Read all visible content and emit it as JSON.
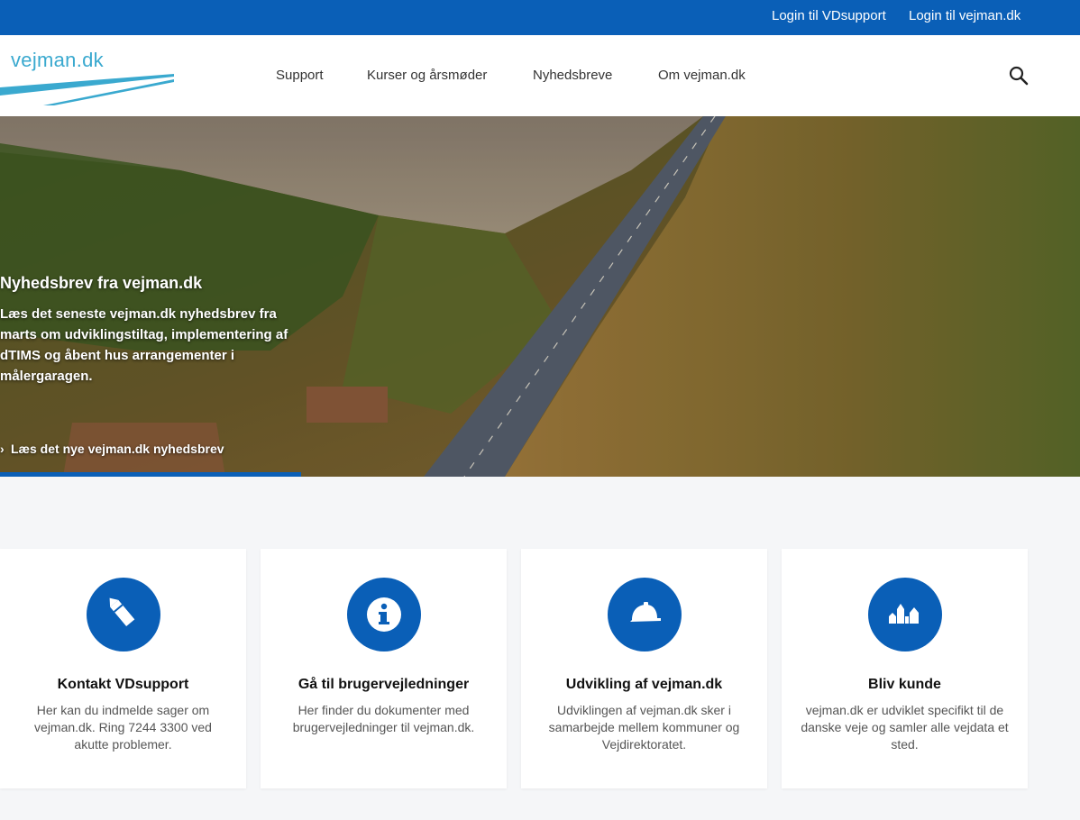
{
  "topbar": {
    "login_vdsupport": "Login til VDsupport",
    "login_vejman": "Login til vejman.dk"
  },
  "header": {
    "logo_text": "vejman.dk",
    "nav": [
      "Support",
      "Kurser og årsmøder",
      "Nyhedsbreve",
      "Om vejman.dk"
    ],
    "search_icon": "search-icon"
  },
  "hero": {
    "title": "Nyhedsbrev fra vejman.dk",
    "text": "Læs det seneste vejman.dk nyhedsbrev fra marts om udviklingstiltag, implementering af dTIMS og åbent hus arrangementer i målergaragen.",
    "link": "Læs det nye vejman.dk nyhedsbrev"
  },
  "cards": [
    {
      "icon": "pencil-icon",
      "title": "Kontakt VDsupport",
      "text": "Her kan du indmelde sager om vejman.dk. Ring 7244 3300 ved akutte problemer."
    },
    {
      "icon": "info-icon",
      "title": "Gå til brugervejledninger",
      "text": "Her finder du dokumenter med brugervejledninger til vejman.dk."
    },
    {
      "icon": "hard-hat-icon",
      "title": "Udvikling af vejman.dk",
      "text": "Udviklingen af vejman.dk sker i samarbejde mellem kommuner og Vejdirektoratet."
    },
    {
      "icon": "town-icon",
      "title": "Bliv kunde",
      "text": "vejman.dk er udviklet specifikt til de danske veje og samler alle vejdata et sted."
    }
  ],
  "colors": {
    "brand_blue": "#0a5fb7",
    "logo_teal": "#3aa9cf"
  }
}
